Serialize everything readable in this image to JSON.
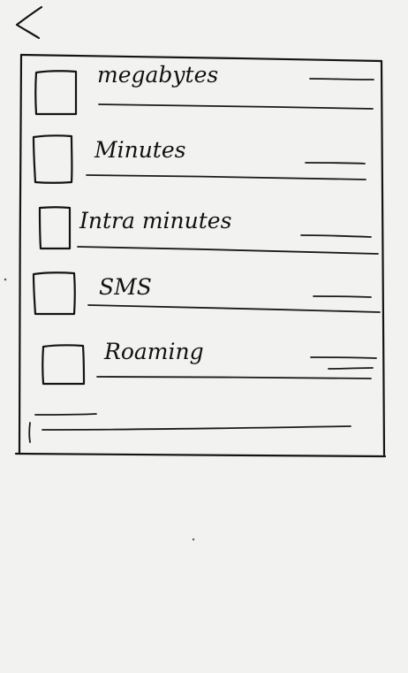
{
  "header": {
    "back_icon": "chevron-left-icon"
  },
  "list": {
    "items": [
      {
        "label": "megabytes",
        "checked": false
      },
      {
        "label": "Minutes",
        "checked": false
      },
      {
        "label": "Intra minutes",
        "checked": false
      },
      {
        "label": "SMS",
        "checked": false
      },
      {
        "label": "Roaming",
        "checked": false
      }
    ]
  }
}
